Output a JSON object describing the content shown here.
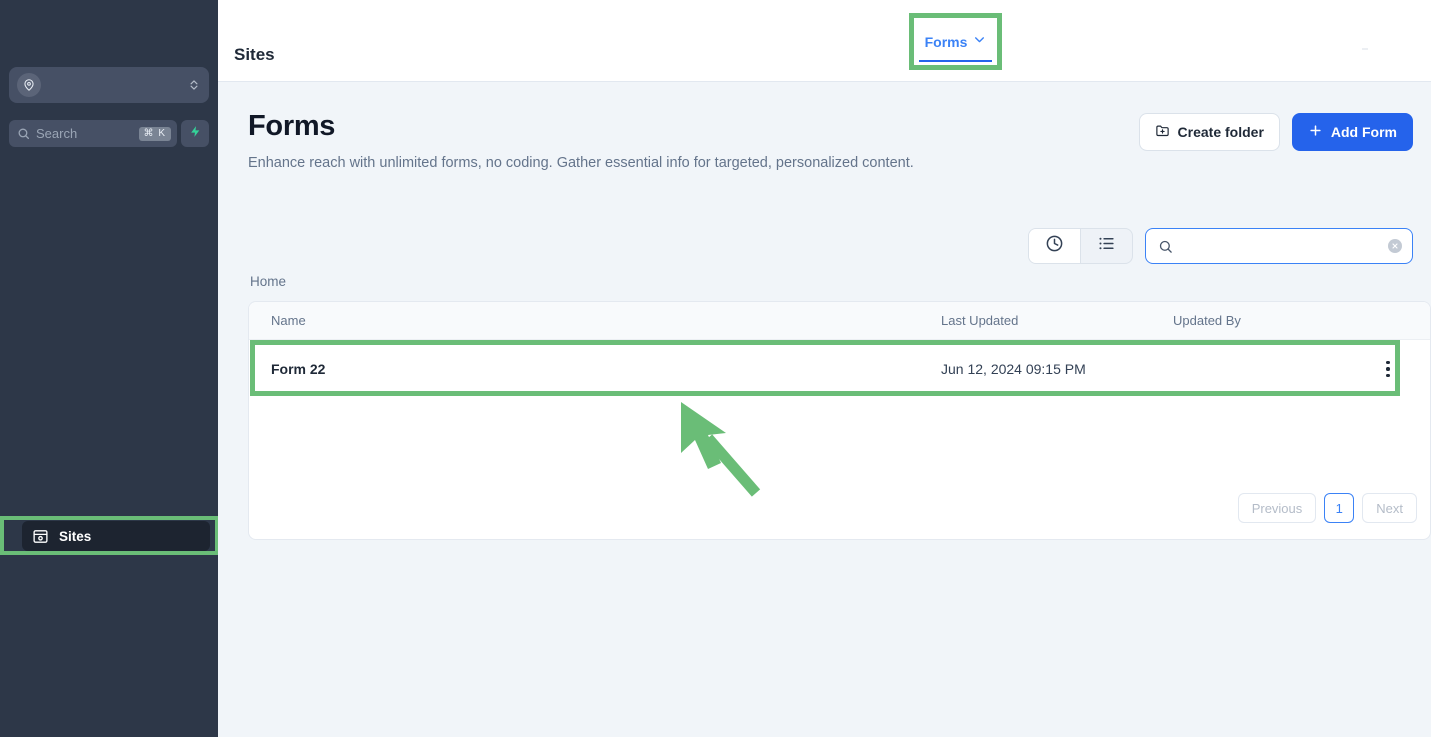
{
  "sidebar": {
    "workspace": {
      "name": "",
      "avatar_icon": "location-pin-icon",
      "chevrons_icon": "chevron-up-down-icon"
    },
    "search": {
      "placeholder": "Search",
      "shortcut": "⌘ K",
      "icon": "search-icon",
      "bolt_icon": "lightning-bolt-icon"
    },
    "nav": [
      {
        "label": "Sites",
        "icon": "sites-window-icon",
        "active": true
      }
    ]
  },
  "topbar": {
    "title": "Sites",
    "tabs": [
      {
        "label": "Forms",
        "icon": "chevron-down-icon",
        "active": true
      }
    ]
  },
  "page": {
    "title": "Forms",
    "subtitle": "Enhance reach with unlimited forms, no coding. Gather essential info for targeted, personalized content.",
    "actions": {
      "create_folder": {
        "label": "Create folder",
        "icon": "folder-plus-icon"
      },
      "add_form": {
        "label": "Add Form",
        "icon": "plus-icon"
      }
    }
  },
  "toolbar": {
    "view_modes": [
      {
        "name": "recent",
        "icon": "clock-icon",
        "active": true
      },
      {
        "name": "list",
        "icon": "list-icon",
        "active": false
      }
    ],
    "search": {
      "value": "",
      "placeholder": "",
      "icon": "search-icon",
      "clear_icon": "clear-circle-icon"
    }
  },
  "breadcrumb": "Home",
  "table": {
    "columns": [
      "Name",
      "Last Updated",
      "Updated By"
    ],
    "rows": [
      {
        "name": "Form 22",
        "last_updated": "Jun 12, 2024 09:15 PM",
        "updated_by": "",
        "menu_icon": "kebab-menu-icon"
      }
    ]
  },
  "pagination": {
    "previous": "Previous",
    "pages": [
      "1"
    ],
    "next": "Next"
  },
  "colors": {
    "highlight": "#6abd77",
    "accent_blue": "#2563eb",
    "link_blue": "#3b82f6",
    "sidebar_bg": "#2d3748",
    "page_bg": "#f1f5f9"
  }
}
